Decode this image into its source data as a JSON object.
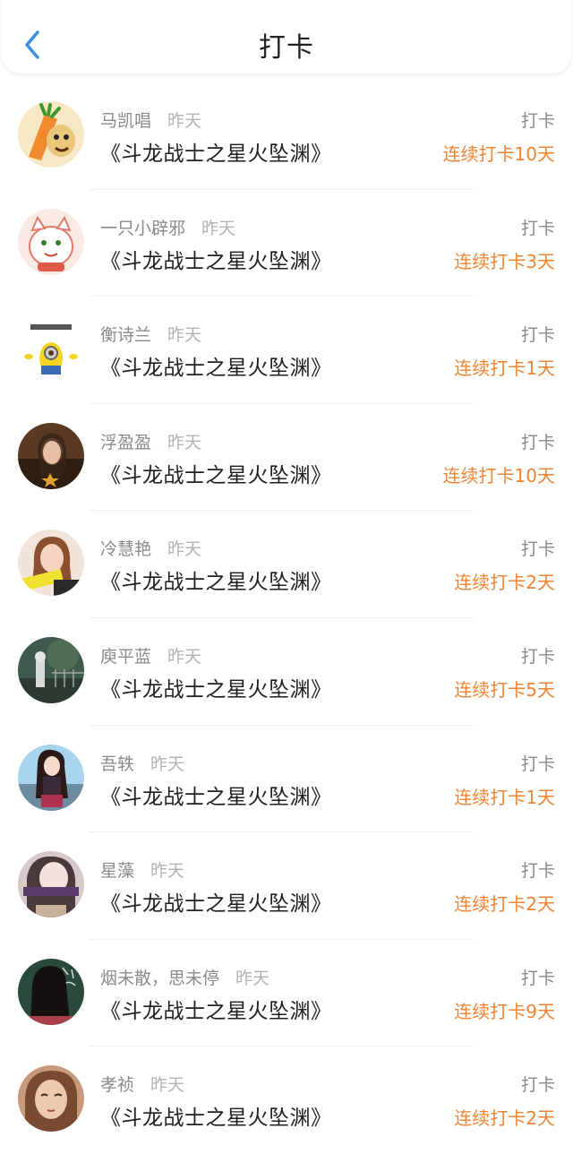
{
  "header": {
    "title": "打卡",
    "back_icon": "chevron-left-icon",
    "back_color": "#3a8ee6"
  },
  "colors": {
    "streak": "#f08433",
    "name": "#8a8a8a",
    "time": "#b3b3b3"
  },
  "items": [
    {
      "name": "马凯唱",
      "time": "昨天",
      "book": "《斗龙战士之星火坠渊》",
      "action": "打卡",
      "streak": "连续打卡10天",
      "avatar": "carrot-cartoon-avatar"
    },
    {
      "name": "一只小辟邪",
      "time": "昨天",
      "book": "《斗龙战士之星火坠渊》",
      "action": "打卡",
      "streak": "连续打卡3天",
      "avatar": "cat-cartoon-avatar"
    },
    {
      "name": "衡诗兰",
      "time": "昨天",
      "book": "《斗龙战士之星火坠渊》",
      "action": "打卡",
      "streak": "连续打卡1天",
      "avatar": "minion-avatar"
    },
    {
      "name": "浮盈盈",
      "time": "昨天",
      "book": "《斗龙战士之星火坠渊》",
      "action": "打卡",
      "streak": "连续打卡10天",
      "avatar": "girl-photo-avatar"
    },
    {
      "name": "冷慧艳",
      "time": "昨天",
      "book": "《斗龙战士之星火坠渊》",
      "action": "打卡",
      "streak": "连续打卡2天",
      "avatar": "girl-photo-avatar"
    },
    {
      "name": "庾平蓝",
      "time": "昨天",
      "book": "《斗龙战士之星火坠渊》",
      "action": "打卡",
      "streak": "连续打卡5天",
      "avatar": "park-photo-avatar"
    },
    {
      "name": "吾轶",
      "time": "昨天",
      "book": "《斗龙战士之星火坠渊》",
      "action": "打卡",
      "streak": "连续打卡1天",
      "avatar": "anime-girl-avatar"
    },
    {
      "name": "星藻",
      "time": "昨天",
      "book": "《斗龙战士之星火坠渊》",
      "action": "打卡",
      "streak": "连续打卡2天",
      "avatar": "girl-photo-avatar"
    },
    {
      "name": "烟未散，思未停",
      "time": "昨天",
      "book": "《斗龙战士之星火坠渊》",
      "action": "打卡",
      "streak": "连续打卡9天",
      "avatar": "chalkboard-girl-avatar"
    },
    {
      "name": "孝祯",
      "time": "昨天",
      "book": "《斗龙战士之星火坠渊》",
      "action": "打卡",
      "streak": "连续打卡2天",
      "avatar": "sketch-girl-avatar"
    }
  ]
}
